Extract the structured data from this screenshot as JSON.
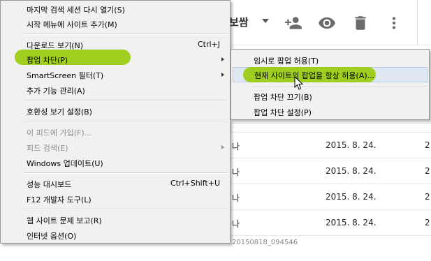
{
  "background": {
    "toolbar": {
      "more_label": "보쌈",
      "icons": [
        "add-person-icon",
        "eye-icon",
        "trash-icon",
        "more-vert-icon"
      ]
    },
    "rows": [
      {
        "stub": "",
        "date": "",
        "date2": ""
      },
      {
        "stub": "나",
        "date": "2015. 8. 24.",
        "date2": "2"
      },
      {
        "stub": "나",
        "date": "2015. 8. 24.",
        "date2": "2"
      },
      {
        "stub": "나",
        "date": "2015. 8. 24.",
        "date2": "2"
      },
      {
        "stub": "나",
        "date": "2015. 8. 24.",
        "date2": "2"
      },
      {
        "stub": "",
        "date": "",
        "date2": "",
        "id": "20150818_094546"
      }
    ]
  },
  "menu": {
    "items": [
      {
        "label": "마지막 검색 세션 다시 열기(S)"
      },
      {
        "label": "시작 메뉴에 사이트 추가(M)"
      },
      {
        "label": "다운로드 보기(N)",
        "shortcut": "Ctrl+J"
      },
      {
        "label": "팝업 차단(P)"
      },
      {
        "label": "SmartScreen 필터(T)"
      },
      {
        "label": "추가 기능 관리(A)"
      },
      {
        "label": "호환성 보기 설정(B)"
      },
      {
        "label": "이 피드에 가입(F)..."
      },
      {
        "label": "피드 검색(E)"
      },
      {
        "label": "Windows 업데이트(U)"
      },
      {
        "label": "성능 대시보드",
        "shortcut": "Ctrl+Shift+U"
      },
      {
        "label": "F12 개발자 도구(L)"
      },
      {
        "label": "웹 사이트 문제 보고(R)"
      },
      {
        "label": "인터넷 옵션(O)"
      }
    ]
  },
  "submenu": {
    "items": [
      {
        "label": "임시로 팝업 허용(T)"
      },
      {
        "label": "현재 사이트의 팝업을 항상 허용(A)..."
      },
      {
        "label": "팝업 차단 끄기(B)"
      },
      {
        "label": "팝업 차단 설정(P)"
      }
    ]
  },
  "colors": {
    "highlight": "#9ccc14",
    "menu_bg": "#f1f1f1",
    "hover_bg": "#dfe8f3"
  }
}
